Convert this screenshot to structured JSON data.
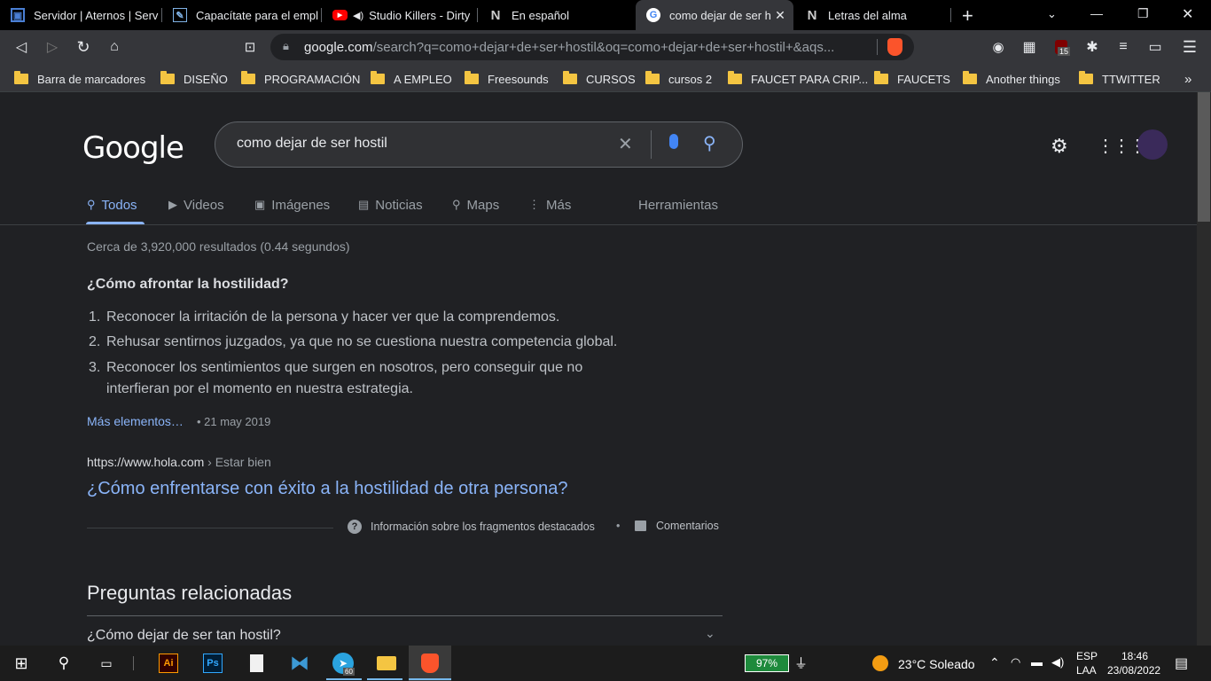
{
  "tabs": [
    {
      "title": "Servidor | Aternos | Serv",
      "icon": "aternos-icon"
    },
    {
      "title": "Capacítate para el empl",
      "icon": "edit-icon"
    },
    {
      "title": "Studio Killers - Dirty",
      "icon": "youtube-icon"
    },
    {
      "title": "En español",
      "icon": "nf-icon"
    },
    {
      "title": "como dejar de ser h",
      "icon": "google-icon"
    },
    {
      "title": "Letras del alma",
      "icon": "nf-icon"
    }
  ],
  "toolbar": {
    "url_host": "google.com",
    "url_path": "/search?q=como+dejar+de+ser+hostil&oq=como+dejar+de+ser+hostil+&aqs...",
    "badge_count": "15"
  },
  "bookmarks": [
    "Barra de marcadores",
    "DISEÑO",
    "PROGRAMACIÓN",
    "A EMPLEO",
    "Freesounds",
    "CURSOS",
    "cursos 2",
    "FAUCET PARA CRIP...",
    "FAUCETS",
    "Another things",
    "TTWITTER"
  ],
  "bookmarks_more": "»",
  "google": {
    "logo": "Google",
    "query": "como dejar de ser hostil",
    "nav": [
      "Todos",
      "Videos",
      "Imágenes",
      "Noticias",
      "Maps",
      "Más"
    ],
    "tools": "Herramientas",
    "stats": "Cerca de 3,920,000 resultados (0.44 segundos)",
    "snippet_title": "¿Cómo afrontar la hostilidad?",
    "snippet_items": [
      "Reconocer la irritación de la persona y hacer ver que la comprendemos.",
      "Rehusar sentirnos juzgados, ya que no se cuestiona nuestra competencia global.",
      "Reconocer los sentimientos que surgen en nosotros, pero conseguir que no",
      "interfieran por el momento en nuestra estrategia."
    ],
    "more_link": "Más elementos…",
    "more_date": "• 21 may 2019",
    "source_url": "https://www.hola.com",
    "source_crumb": " › Estar bien",
    "result_title": "¿Cómo enfrentarse con éxito a la hostilidad de otra persona?",
    "fragment_info": "Información sobre los fragmentos destacados",
    "feedback": "Comentarios",
    "related_title": "Preguntas relacionadas",
    "related_q1": "¿Cómo dejar de ser tan hostil?"
  },
  "taskbar": {
    "battery": "97%",
    "weather": "23°C  Soleado",
    "lang_top": "ESP",
    "lang_bottom": "LAA",
    "time": "18:46",
    "date": "23/08/2022",
    "telegram_badge": "60"
  },
  "colors": {
    "link": "#8ab4f8",
    "bg": "#202124",
    "accent_brave": "#fb542b"
  }
}
